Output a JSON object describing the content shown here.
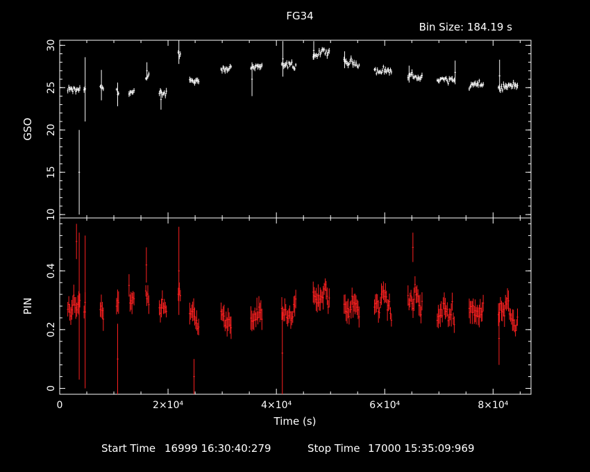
{
  "chart_data": {
    "type": "scatter",
    "title": "FG34",
    "bin_size_label": "Bin Size:",
    "bin_size_value": "184.19 s",
    "xlabel": "Time (s)",
    "xlim": [
      0,
      87000
    ],
    "x_ticks": [
      {
        "value": 0,
        "label": "0"
      },
      {
        "value": 20000,
        "label": "2×10⁴"
      },
      {
        "value": 40000,
        "label": "4×10⁴"
      },
      {
        "value": 60000,
        "label": "6×10⁴"
      },
      {
        "value": 80000,
        "label": "8×10⁴"
      }
    ],
    "panels": [
      {
        "name": "GSO",
        "ylabel": "GSO",
        "ylim": [
          9.6,
          30.6
        ],
        "color": "#ffffff",
        "y_ticks": [
          10,
          15,
          20,
          25,
          30
        ],
        "base_segments": [
          {
            "x": [
              1500,
              3800
            ],
            "mean": 24.6,
            "jitter": 0.6
          },
          {
            "x": [
              4500,
              4800
            ],
            "mean": 24.9,
            "jitter": 0.5
          },
          {
            "x": [
              7500,
              8200
            ],
            "mean": 24.9,
            "jitter": 0.5
          },
          {
            "x": [
              10500,
              11000
            ],
            "mean": 24.6,
            "jitter": 0.5
          },
          {
            "x": [
              12800,
              13800
            ],
            "mean": 24.4,
            "jitter": 0.6
          },
          {
            "x": [
              15900,
              16600
            ],
            "mean": 25.6,
            "jitter": 1.0
          },
          {
            "x": [
              18400,
              19800
            ],
            "mean": 24.5,
            "jitter": 0.7
          },
          {
            "x": [
              21900,
              22400
            ],
            "mean": 29.0,
            "jitter": 0.6
          },
          {
            "x": [
              24000,
              25800
            ],
            "mean": 25.9,
            "jitter": 0.5
          },
          {
            "x": [
              29800,
              31800
            ],
            "mean": 27.4,
            "jitter": 0.6
          },
          {
            "x": [
              35300,
              37400
            ],
            "mean": 27.3,
            "jitter": 0.5
          },
          {
            "x": [
              41000,
              43600
            ],
            "mean": 27.5,
            "jitter": 0.7
          },
          {
            "x": [
              46800,
              49800
            ],
            "mean": 29.0,
            "jitter": 0.6
          },
          {
            "x": [
              52500,
              55300
            ],
            "mean": 28.0,
            "jitter": 0.6
          },
          {
            "x": [
              58100,
              61400
            ],
            "mean": 27.0,
            "jitter": 0.6
          },
          {
            "x": [
              64300,
              67000
            ],
            "mean": 26.3,
            "jitter": 0.6
          },
          {
            "x": [
              69700,
              73000
            ],
            "mean": 25.9,
            "jitter": 0.6
          },
          {
            "x": [
              75600,
              78200
            ],
            "mean": 25.2,
            "jitter": 0.6
          },
          {
            "x": [
              81000,
              84500
            ],
            "mean": 25.1,
            "jitter": 0.7
          }
        ],
        "error_bars": [
          {
            "x": 3600,
            "y": 15.0,
            "err": 5.0
          },
          {
            "x": 4700,
            "y": 24.8,
            "err": 3.8
          },
          {
            "x": 7700,
            "y": 25.3,
            "err": 1.8
          },
          {
            "x": 10700,
            "y": 24.2,
            "err": 1.4
          },
          {
            "x": 16100,
            "y": 27.0,
            "err": 1.0
          },
          {
            "x": 18700,
            "y": 23.6,
            "err": 1.2
          },
          {
            "x": 22000,
            "y": 29.2,
            "err": 1.4
          },
          {
            "x": 35500,
            "y": 26.0,
            "err": 2.0
          },
          {
            "x": 41200,
            "y": 28.4,
            "err": 2.1
          },
          {
            "x": 46900,
            "y": 29.4,
            "err": 1.1
          },
          {
            "x": 52600,
            "y": 28.3,
            "err": 1.0
          },
          {
            "x": 64500,
            "y": 26.6,
            "err": 1.0
          },
          {
            "x": 73000,
            "y": 26.8,
            "err": 1.4
          },
          {
            "x": 81200,
            "y": 26.4,
            "err": 1.9
          }
        ]
      },
      {
        "name": "PIN",
        "ylabel": "PIN",
        "ylim": [
          -0.02,
          0.58
        ],
        "color": "#ff2020",
        "y_ticks": [
          0,
          0.2,
          0.4
        ],
        "y_tick_labels": [
          "0",
          "0.2",
          "0.4"
        ],
        "base_segments": [
          {
            "x": [
              1500,
              3800
            ],
            "mean": 0.27,
            "jitter": 0.05
          },
          {
            "x": [
              4500,
              4800
            ],
            "mean": 0.3,
            "jitter": 0.06
          },
          {
            "x": [
              7500,
              8200
            ],
            "mean": 0.27,
            "jitter": 0.05
          },
          {
            "x": [
              10500,
              11000
            ],
            "mean": 0.26,
            "jitter": 0.05
          },
          {
            "x": [
              12800,
              13800
            ],
            "mean": 0.33,
            "jitter": 0.06
          },
          {
            "x": [
              15900,
              16600
            ],
            "mean": 0.33,
            "jitter": 0.07
          },
          {
            "x": [
              18400,
              19800
            ],
            "mean": 0.27,
            "jitter": 0.05
          },
          {
            "x": [
              21900,
              22400
            ],
            "mean": 0.3,
            "jitter": 0.08
          },
          {
            "x": [
              24000,
              25800
            ],
            "mean": 0.25,
            "jitter": 0.05
          },
          {
            "x": [
              29800,
              31800
            ],
            "mean": 0.24,
            "jitter": 0.05
          },
          {
            "x": [
              35300,
              37400
            ],
            "mean": 0.25,
            "jitter": 0.05
          },
          {
            "x": [
              41000,
              43600
            ],
            "mean": 0.27,
            "jitter": 0.05
          },
          {
            "x": [
              46800,
              49800
            ],
            "mean": 0.3,
            "jitter": 0.05
          },
          {
            "x": [
              52500,
              55300
            ],
            "mean": 0.28,
            "jitter": 0.05
          },
          {
            "x": [
              58100,
              61400
            ],
            "mean": 0.27,
            "jitter": 0.07
          },
          {
            "x": [
              64300,
              67000
            ],
            "mean": 0.29,
            "jitter": 0.07
          },
          {
            "x": [
              69700,
              73000
            ],
            "mean": 0.26,
            "jitter": 0.06
          },
          {
            "x": [
              75600,
              78200
            ],
            "mean": 0.27,
            "jitter": 0.05
          },
          {
            "x": [
              81000,
              84500
            ],
            "mean": 0.26,
            "jitter": 0.06
          }
        ],
        "error_bars": [
          {
            "x": 3100,
            "y": 0.5,
            "err": 0.06
          },
          {
            "x": 3600,
            "y": 0.28,
            "err": 0.25
          },
          {
            "x": 4700,
            "y": 0.26,
            "err": 0.26
          },
          {
            "x": 10700,
            "y": 0.1,
            "err": 0.12
          },
          {
            "x": 16000,
            "y": 0.42,
            "err": 0.06
          },
          {
            "x": 22000,
            "y": 0.4,
            "err": 0.15
          },
          {
            "x": 24800,
            "y": 0.04,
            "err": 0.06
          },
          {
            "x": 41100,
            "y": 0.12,
            "err": 0.14
          },
          {
            "x": 65200,
            "y": 0.48,
            "err": 0.05
          },
          {
            "x": 81100,
            "y": 0.17,
            "err": 0.09
          }
        ]
      }
    ]
  },
  "footer": {
    "start_label": "Start Time",
    "start_value": "16999 16:30:40:279",
    "stop_label": "Stop Time",
    "stop_value": "17000 15:35:09:969"
  }
}
